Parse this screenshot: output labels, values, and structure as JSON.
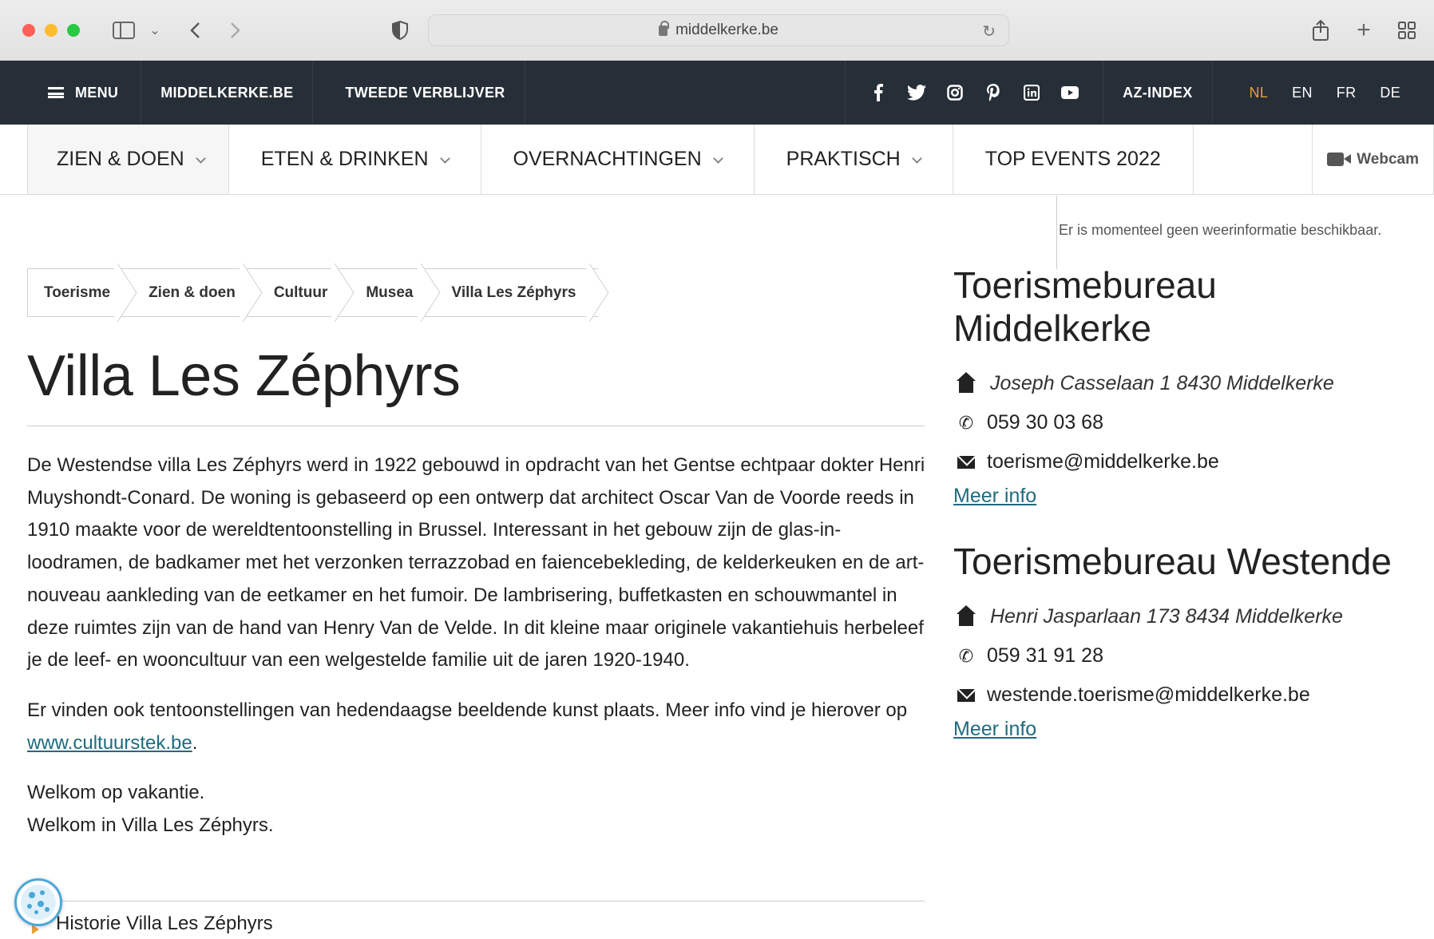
{
  "browser": {
    "url": "middelkerke.be"
  },
  "topbar": {
    "menu_label": "MENU",
    "site_label": "MIDDELKERKE.BE",
    "second_home_label": "TWEEDE VERBLIJVER",
    "socials": [
      "facebook",
      "twitter",
      "instagram",
      "pinterest",
      "linkedin",
      "youtube"
    ],
    "az_index_label": "AZ-INDEX",
    "languages": [
      "NL",
      "EN",
      "FR",
      "DE"
    ],
    "active_language": "NL",
    "accent_color": "#e8a23a"
  },
  "mainnav": {
    "items": [
      {
        "label": "ZIEN & DOEN"
      },
      {
        "label": "ETEN & DRINKEN"
      },
      {
        "label": "OVERNACHTINGEN"
      },
      {
        "label": "PRAKTISCH"
      },
      {
        "label": "TOP EVENTS 2022"
      }
    ],
    "webcam_label": "Webcam"
  },
  "weather": {
    "message": "Er is momenteel geen weerinformatie beschikbaar."
  },
  "breadcrumb": [
    "Toerisme",
    "Zien & doen",
    "Cultuur",
    "Musea",
    "Villa Les Zéphyrs"
  ],
  "page": {
    "title": "Villa Les Zéphyrs",
    "paragraph1": "De Westendse villa Les Zéphyrs werd in 1922 gebouwd in opdracht van het Gentse echtpaar dokter Henri Muyshondt-Conard. De woning is gebaseerd op een ontwerp dat architect Oscar Van de Voorde reeds in 1910 maakte voor de wereldtentoonstelling in Brussel. Interessant in het gebouw zijn de glas-in-loodramen, de badkamer met het verzonken terrazzobad en faiencebekleding, de kelderkeuken en de art-nouveau aankleding van de eetkamer en het fumoir. De lambrisering, buffetkasten en schouwmantel in deze ruimtes zijn van de hand van Henry Van de Velde. In dit kleine maar originele vakantiehuis herbeleef je de leef- en wooncultuur van een welgestelde familie uit de jaren 1920-1940.",
    "paragraph2_text": "Er vinden ook tentoonstellingen van hedendaagse beeldende kunst plaats. Meer info vind je hierover op ",
    "paragraph2_link": "www.cultuurstek.be",
    "paragraph2_end": ".",
    "welcome1": "Welkom op vakantie.",
    "welcome2": "Welkom in Villa Les Zéphyrs.",
    "accordion_label": "Historie Villa Les Zéphyrs",
    "link_color": "#1f6b80"
  },
  "sidebar": {
    "offices": [
      {
        "title": "Toerismebureau Middelkerke",
        "address": "Joseph Casselaan 1 8430 Middelkerke",
        "phone": "059 30 03 68",
        "email": "toerisme@middelkerke.be",
        "more_label": "Meer info"
      },
      {
        "title": "Toerismebureau Westende",
        "address": "Henri Jasparlaan 173 8434 Middelkerke",
        "phone": "059 31 91 28",
        "email": "westende.toerisme@middelkerke.be",
        "more_label": "Meer info"
      }
    ]
  }
}
